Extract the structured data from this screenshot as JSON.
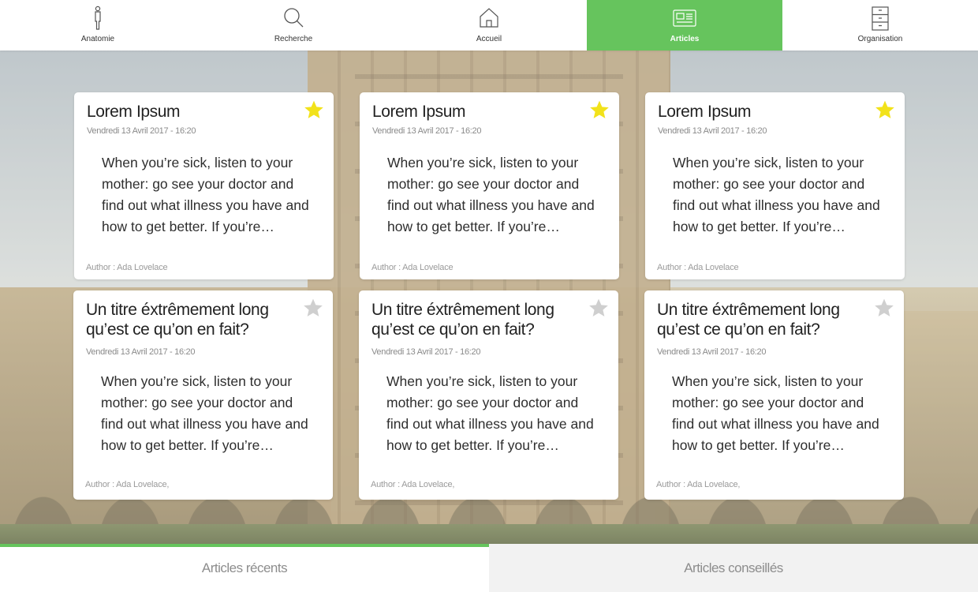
{
  "nav": {
    "items": [
      {
        "label": "Anatomie",
        "icon": "person-icon"
      },
      {
        "label": "Recherche",
        "icon": "search-icon"
      },
      {
        "label": "Accueil",
        "icon": "home-icon"
      },
      {
        "label": "Articles",
        "icon": "newspaper-icon",
        "active": true
      },
      {
        "label": "Organisation",
        "icon": "cabinet-icon"
      }
    ],
    "active_color": "#66c45d"
  },
  "articles": [
    {
      "title": "Lorem Ipsum",
      "date": "Vendredi 13 Avril 2017 - 16:20",
      "excerpt": "When you’re sick, listen to your mother: go see your doctor and find out what illness you have and how to get better. If you’re…",
      "author": "Author : Ada Lovelace",
      "starred": true
    },
    {
      "title": "Lorem Ipsum",
      "date": "Vendredi 13 Avril 2017 - 16:20",
      "excerpt": "When you’re sick, listen to your mother: go see your doctor and find out what illness you have and how to get better. If you’re…",
      "author": "Author : Ada Lovelace",
      "starred": true
    },
    {
      "title": "Lorem Ipsum",
      "date": "Vendredi 13 Avril 2017 - 16:20",
      "excerpt": "When you’re sick, listen to your mother: go see your doctor and find out what illness you have and how to get better. If you’re…",
      "author": "Author : Ada Lovelace",
      "starred": true
    },
    {
      "title": "Un titre éxtrêmement long qu’est ce qu’on en fait?",
      "date": "Vendredi 13 Avril 2017 - 16:20",
      "excerpt": "When you’re sick, listen to your mother: go see your doctor and find out what illness you have and how to get better. If you’re…",
      "author": "Author : Ada Lovelace,",
      "starred": false
    },
    {
      "title": "Un titre éxtrêmement long qu’est ce qu’on en fait?",
      "date": "Vendredi 13 Avril 2017 - 16:20",
      "excerpt": "When you’re sick, listen to your mother: go see your doctor and find out what illness you have and how to get better. If you’re…",
      "author": "Author : Ada Lovelace,",
      "starred": false
    },
    {
      "title": "Un titre éxtrêmement long qu’est ce qu’on en fait?",
      "date": "Vendredi 13 Avril 2017 - 16:20",
      "excerpt": "When you’re sick, listen to your mother: go see your doctor and find out what illness you have and how to get better. If you’re…",
      "author": "Author : Ada Lovelace,",
      "starred": false
    }
  ],
  "star_colors": {
    "on": "#f2e21a",
    "off": "#cfcfcf"
  },
  "bottom_tabs": [
    {
      "label": "Articles récents",
      "active": true
    },
    {
      "label": "Articles conseillés",
      "active": false
    }
  ]
}
